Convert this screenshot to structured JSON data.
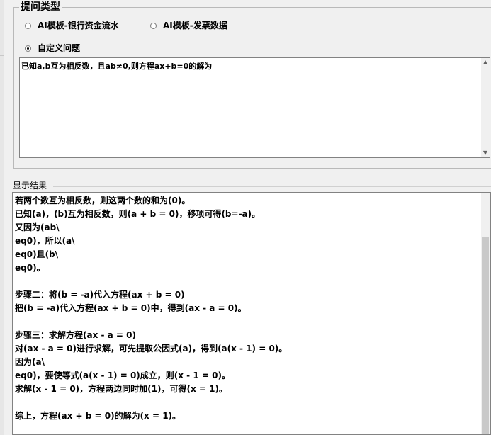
{
  "group": {
    "title": "提问类型",
    "options": [
      {
        "label": "AI模板-银行资金流水",
        "checked": false
      },
      {
        "label": "AI模板-发票数据",
        "checked": false
      },
      {
        "label": "自定义问题",
        "checked": true
      }
    ]
  },
  "question": {
    "text": "已知a,b互为相反数，且ab≠0,则方程ax+b=0的解为"
  },
  "result": {
    "label": "显示结果",
    "text": "若两个数互为相反数，则这两个数的和为(0)。\n已知(a)，(b)互为相反数，则(a + b = 0)，移项可得(b=-a)。\n又因为(ab\\\neq0)，所以(a\\\neq0)且(b\\\neq0)。\n\n步骤二：将(b = -a)代入方程(ax + b = 0)\n把(b = -a)代入方程(ax + b = 0)中，得到(ax - a = 0)。\n\n步骤三：求解方程(ax - a = 0)\n对(ax - a = 0)进行求解，可先提取公因式(a)，得到(a(x - 1) = 0)。\n因为(a\\\neq0)，要使等式(a(x - 1) = 0)成立，则(x - 1 = 0)。\n求解(x - 1 = 0)，方程两边同时加(1)，可得(x = 1)。\n\n综上，方程(ax + b = 0)的解为(x = 1)。"
  },
  "icons": {
    "scroll_up": "scroll-up-arrow-icon",
    "scroll_down": "scroll-down-arrow-icon"
  }
}
